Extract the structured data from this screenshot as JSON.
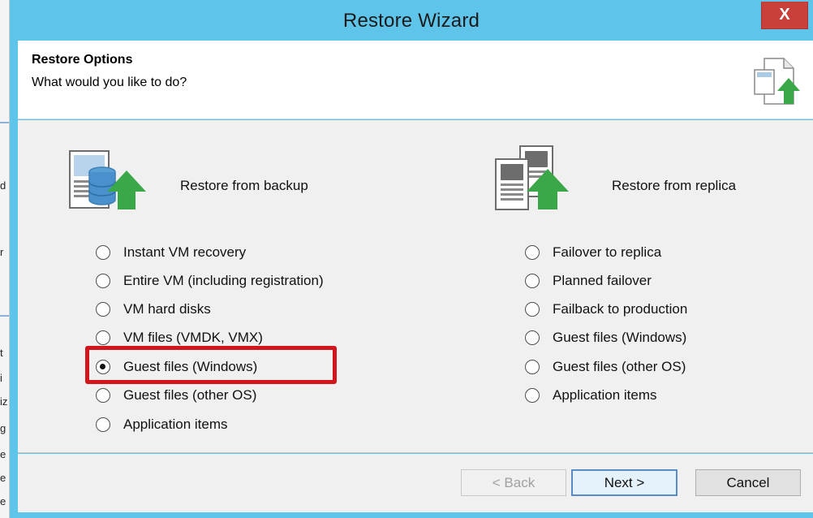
{
  "window": {
    "title": "Restore Wizard",
    "close_glyph": "X"
  },
  "background": {
    "edge_chars": [
      "d",
      "r",
      "t",
      "i",
      "iz",
      "g",
      "e",
      "e",
      "e"
    ]
  },
  "header": {
    "title": "Restore Options",
    "subtitle": "What would you like to do?",
    "icon": "restore-document-icon"
  },
  "backup": {
    "title": "Restore from backup",
    "icon": "backup-database-icon",
    "options": [
      {
        "label": "Instant VM recovery",
        "checked": false
      },
      {
        "label": "Entire VM (including registration)",
        "checked": false
      },
      {
        "label": "VM hard disks",
        "checked": false
      },
      {
        "label": "VM files (VMDK, VMX)",
        "checked": false
      },
      {
        "label": "Guest files (Windows)",
        "checked": true
      },
      {
        "label": "Guest files (other OS)",
        "checked": false
      },
      {
        "label": "Application items",
        "checked": false
      }
    ]
  },
  "replica": {
    "title": "Restore from replica",
    "icon": "replica-servers-icon",
    "options": [
      {
        "label": "Failover to replica",
        "checked": false
      },
      {
        "label": "Planned failover",
        "checked": false
      },
      {
        "label": "Failback to production",
        "checked": false
      },
      {
        "label": "Guest files (Windows)",
        "checked": false
      },
      {
        "label": "Guest files (other OS)",
        "checked": false
      },
      {
        "label": "Application items",
        "checked": false
      }
    ]
  },
  "footer": {
    "back_label": "< Back",
    "next_label": "Next >",
    "cancel_label": "Cancel"
  },
  "colors": {
    "titlebar": "#5fc4ea",
    "highlight": "#d3141b",
    "arrow_green": "#3aa849",
    "close_red": "#c9403a"
  }
}
